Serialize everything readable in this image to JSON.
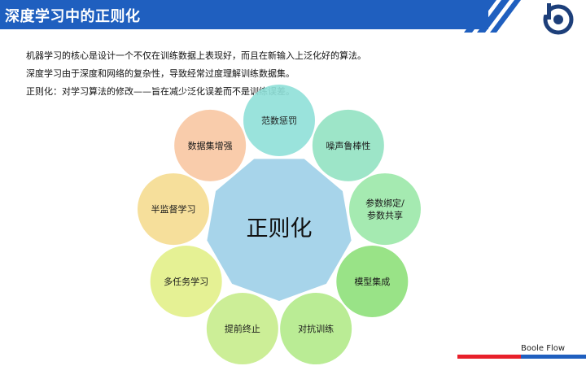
{
  "header": {
    "title": "深度学习中的正则化",
    "bar_color": "#1f5fbf"
  },
  "bullets": [
    "机器学习的核心是设计一个不仅在训练数据上表现好，而且在新输入上泛化好的算法。",
    "深度学习由于深度和网络的复杂性，导致经常过度理解训练数据集。",
    "正则化：对学习算法的修改——旨在减少泛化误差而不是训练误差。"
  ],
  "diagram": {
    "center_label": "正则化",
    "center_color": "#9fd0e8",
    "petals": [
      {
        "lines": [
          "范数惩罚"
        ],
        "color": "#8fe0d8"
      },
      {
        "lines": [
          "噪声鲁棒性"
        ],
        "color": "#92e2c2"
      },
      {
        "lines": [
          "参数绑定/",
          "参数共享"
        ],
        "color": "#9be8a8"
      },
      {
        "lines": [
          "模型集成"
        ],
        "color": "#8ee07a"
      },
      {
        "lines": [
          "对抗训练"
        ],
        "color": "#b2ea8a"
      },
      {
        "lines": [
          "提前终止"
        ],
        "color": "#c7ec8c"
      },
      {
        "lines": [
          "多任务学习"
        ],
        "color": "#e2f088"
      },
      {
        "lines": [
          "半监督学习"
        ],
        "color": "#f5dc90"
      },
      {
        "lines": [
          "数据集增强"
        ],
        "color": "#f8c7a2"
      }
    ]
  },
  "footer": {
    "brand": "Boole Flow",
    "red": "#e8202a",
    "blue": "#1f5fbf"
  }
}
